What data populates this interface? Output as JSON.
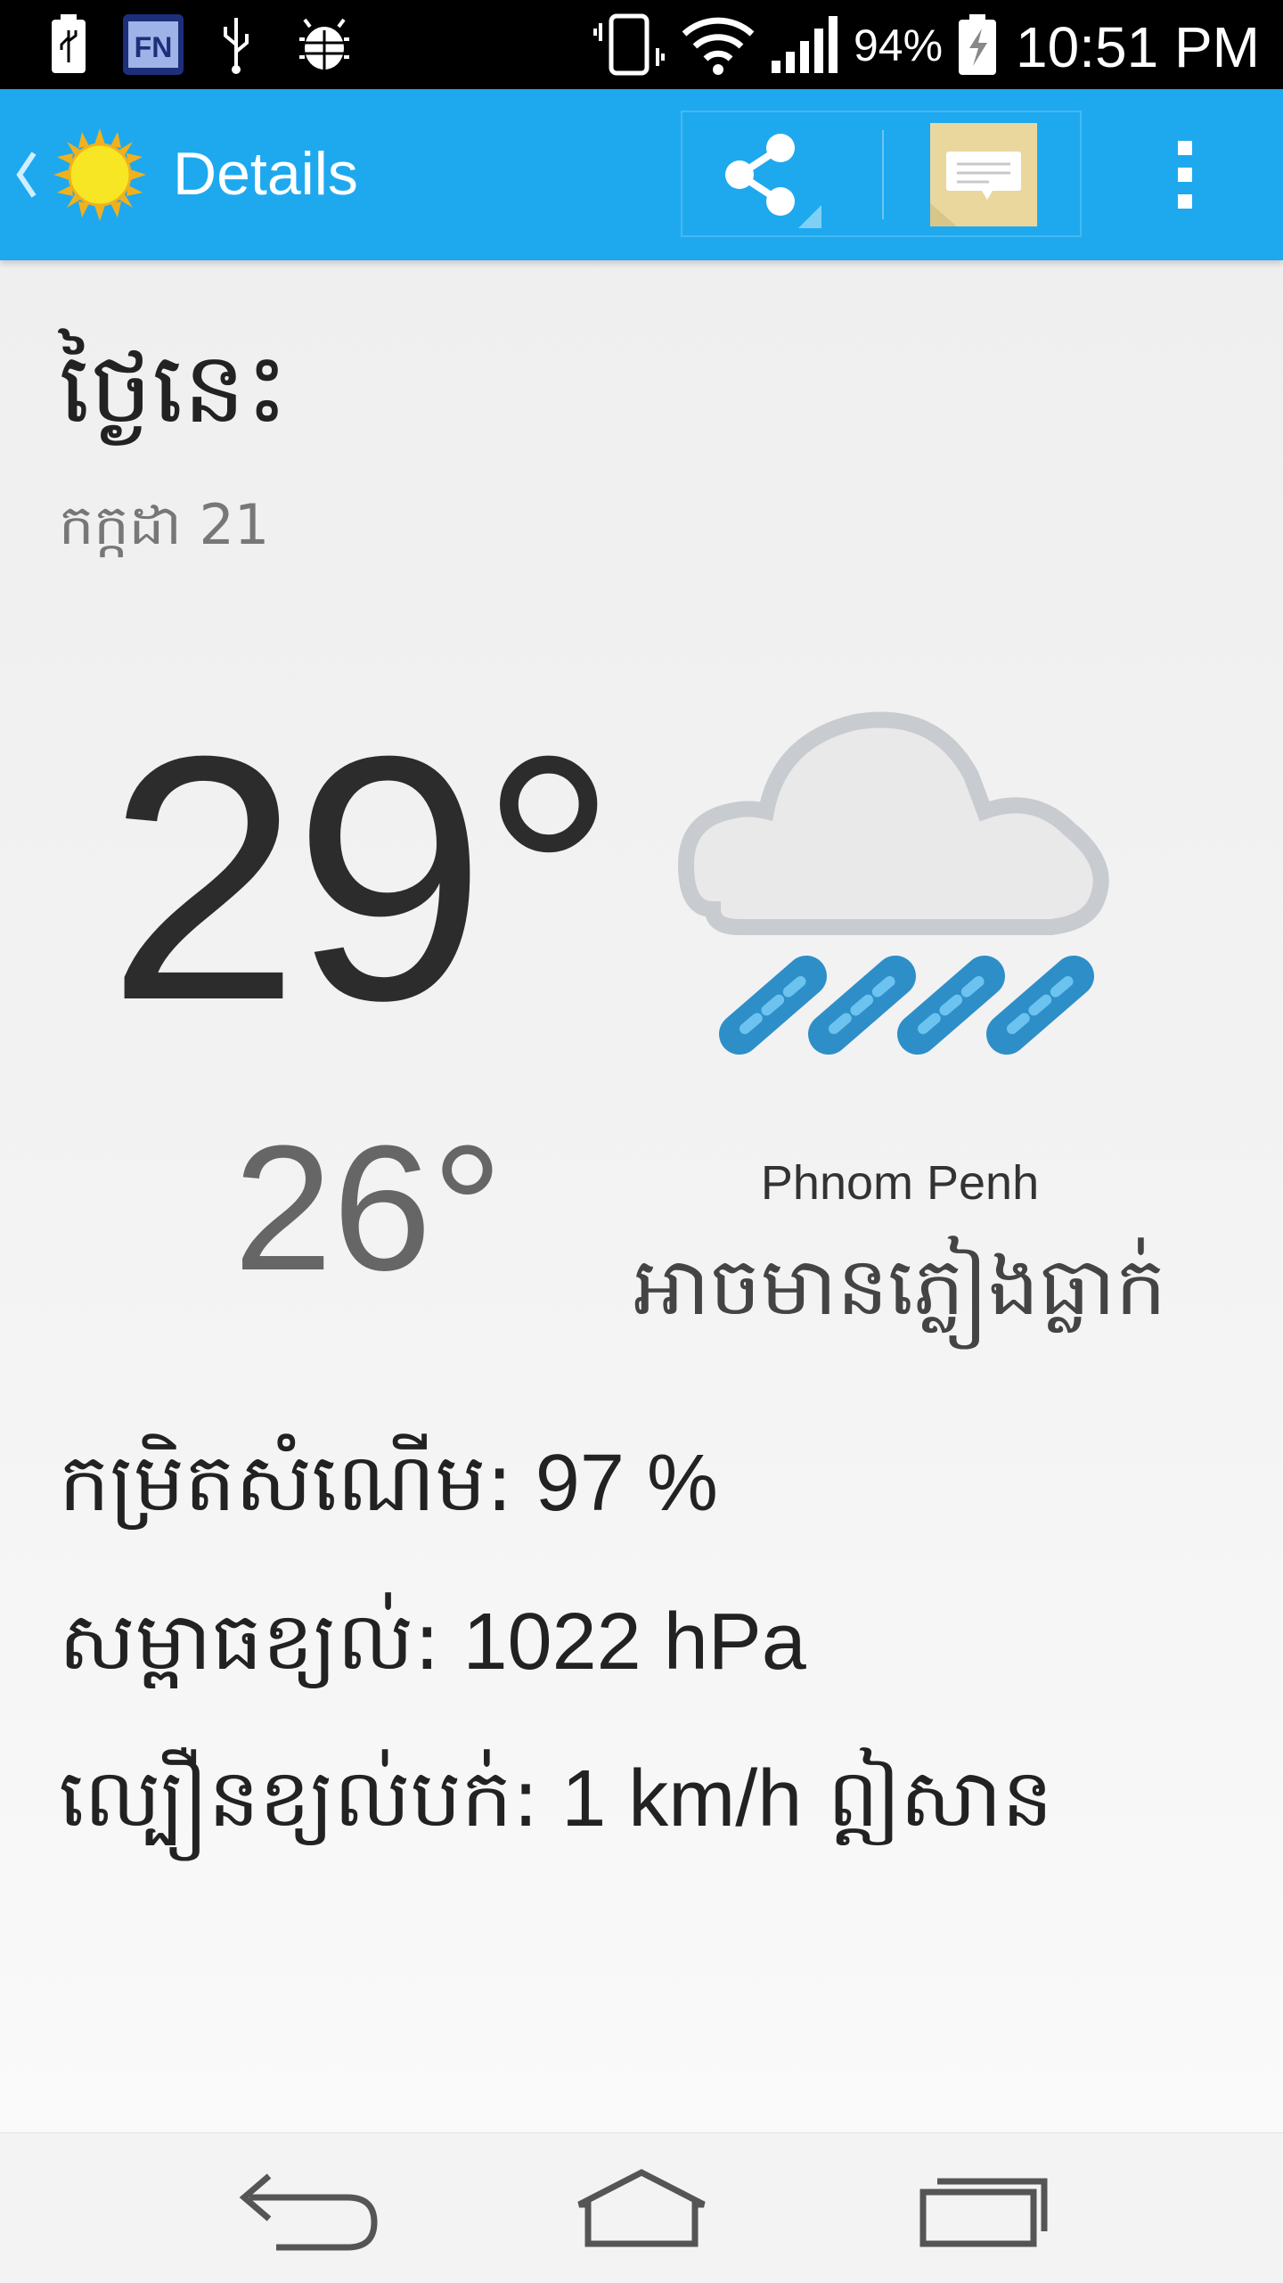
{
  "status_bar": {
    "icons": [
      "usb-battery-icon",
      "fn-app-icon",
      "usb-icon",
      "android-debug-icon",
      "vibrate-icon",
      "wifi-icon",
      "signal-icon",
      "battery-charging-icon"
    ],
    "battery_percent": "94%",
    "time": "10:51 PM"
  },
  "action_bar": {
    "title": "Details",
    "actions": [
      "share-icon",
      "message-icon",
      "overflow-icon"
    ]
  },
  "day": {
    "title": "ថ្ងៃនេះ",
    "date": "កក្កដា 21"
  },
  "temperature": {
    "high": "29°",
    "low": "26°"
  },
  "weather": {
    "icon": "rain-cloud-icon",
    "location": "Phnom Penh",
    "forecast": "អាចមានភ្លៀងធ្លាក់"
  },
  "details": [
    {
      "label": "កម្រិតសំណើម:",
      "value": " 97 %"
    },
    {
      "label": "សម្ពាធខ្យល់:",
      "value": " 1022 hPa"
    },
    {
      "label": "ល្បឿនខ្យល់បក់:",
      "value": "  1 km/h",
      "suffix": " ឦសាន"
    }
  ],
  "colors": {
    "action_bar": "#1ea9ef",
    "status_bar": "#000000",
    "rain": "#2e8fc8"
  },
  "nav_bar": [
    "back-icon",
    "home-icon",
    "recent-apps-icon"
  ]
}
